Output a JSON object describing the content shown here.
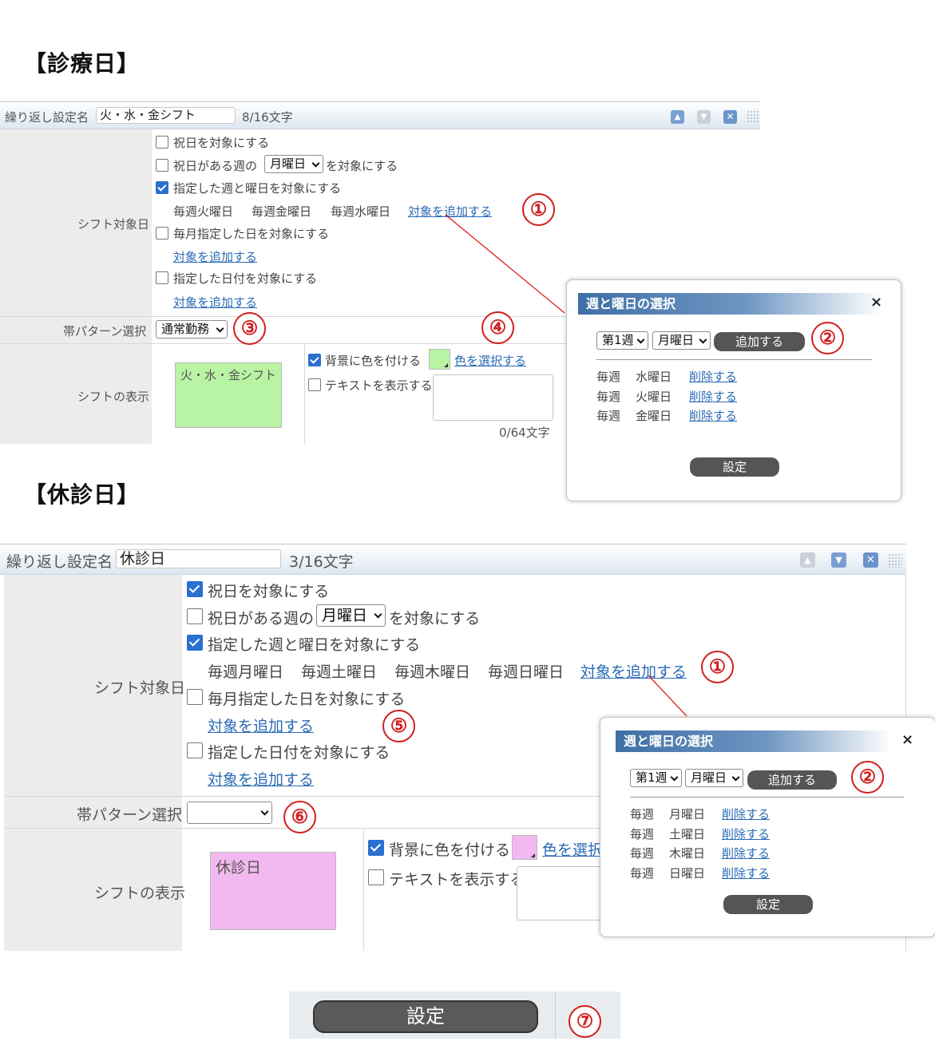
{
  "section1": {
    "title": "【診療日】",
    "header": {
      "name_label": "繰り返し設定名",
      "name_value": "火・水・金シフト",
      "char_count": "8/16文字"
    },
    "target_label": "シフト対象日",
    "options": [
      {
        "label": "祝日を対象にする",
        "checked": false
      },
      {
        "label_before": "祝日がある週の",
        "select": "月曜日",
        "label_after": "を対象にする",
        "checked": false
      },
      {
        "label": "指定した週と曜日を対象にする",
        "checked": true
      },
      {
        "label": "毎月指定した日を対象にする",
        "checked": false
      },
      {
        "label": "指定した日付を対象にする",
        "checked": false
      }
    ],
    "weekly_items": [
      "毎週火曜日",
      "毎週金曜日",
      "毎週水曜日"
    ],
    "add_link": "対象を追加する",
    "band_label": "帯パターン選択",
    "band_value": "通常勤務",
    "display_label": "シフトの表示",
    "preview_text": "火・水・金シフト",
    "preview_color": "#b9f3a4",
    "bg_color_label": "背景に色を付ける",
    "bg_color_checked": true,
    "color_link": "色を選択する",
    "text_label": "テキストを表示する",
    "text_checked": false,
    "text_count": "0/64文字",
    "dialog": {
      "title": "週と曜日の選択",
      "close": "×",
      "week_select": "第1週",
      "day_select": "月曜日",
      "add_button": "追加する",
      "rows": [
        {
          "week": "毎週",
          "day": "水曜日",
          "action": "削除する"
        },
        {
          "week": "毎週",
          "day": "火曜日",
          "action": "削除する"
        },
        {
          "week": "毎週",
          "day": "金曜日",
          "action": "削除する"
        }
      ],
      "ok_button": "設定"
    }
  },
  "section2": {
    "title": "【休診日】",
    "header": {
      "name_label": "繰り返し設定名",
      "name_value": "休診日",
      "char_count": "3/16文字"
    },
    "target_label": "シフト対象日",
    "options": [
      {
        "label": "祝日を対象にする",
        "checked": true
      },
      {
        "label_before": "祝日がある週の",
        "select": "月曜日",
        "label_after": "を対象にする",
        "checked": false
      },
      {
        "label": "指定した週と曜日を対象にする",
        "checked": true
      },
      {
        "label": "毎月指定した日を対象にする",
        "checked": false
      },
      {
        "label": "指定した日付を対象にする",
        "checked": false
      }
    ],
    "weekly_items": [
      "毎週月曜日",
      "毎週土曜日",
      "毎週木曜日",
      "毎週日曜日"
    ],
    "add_link": "対象を追加する",
    "band_label": "帯パターン選択",
    "band_value": "",
    "display_label": "シフトの表示",
    "preview_text": "休診日",
    "preview_color": "#f2b8f0",
    "bg_color_label": "背景に色を付ける",
    "bg_color_checked": true,
    "color_link": "色を選択",
    "text_label": "テキストを表示する",
    "text_checked": false,
    "dialog": {
      "title": "週と曜日の選択",
      "close": "×",
      "week_select": "第1週",
      "day_select": "月曜日",
      "add_button": "追加する",
      "rows": [
        {
          "week": "毎週",
          "day": "月曜日",
          "action": "削除する"
        },
        {
          "week": "毎週",
          "day": "土曜日",
          "action": "削除する"
        },
        {
          "week": "毎週",
          "day": "木曜日",
          "action": "削除する"
        },
        {
          "week": "毎週",
          "day": "日曜日",
          "action": "削除する"
        }
      ],
      "ok_button": "設定"
    }
  },
  "footer": {
    "submit": "設定"
  },
  "annotations": [
    "①",
    "②",
    "③",
    "④",
    "⑤",
    "⑥",
    "⑦"
  ],
  "colors": {
    "annotation": "#d21e1e",
    "link": "#2a6bb5",
    "checkbox": "#2b6fd0"
  }
}
